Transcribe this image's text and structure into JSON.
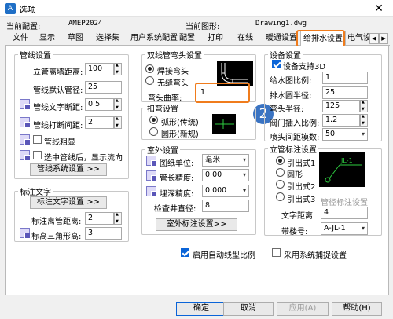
{
  "window": {
    "title": "选项",
    "close": "✕"
  },
  "info": {
    "current_config_label": "当前配置:",
    "current_config_value": "AMEP2024",
    "current_drawing_label": "当前图形:",
    "current_drawing_value": "Drawing1.dwg"
  },
  "tabs": [
    {
      "label": "文件"
    },
    {
      "label": "显示"
    },
    {
      "label": "草图"
    },
    {
      "label": "选择集"
    },
    {
      "label": "用户系统配置"
    },
    {
      "label": "配置"
    },
    {
      "label": "打印"
    },
    {
      "label": "在线"
    },
    {
      "label": "暖通设置"
    },
    {
      "label": "给排水设置"
    },
    {
      "label": "电气设"
    }
  ],
  "pipe": {
    "title": "管线设置",
    "elev_label": "立管离墙距离:",
    "elev_value": "100",
    "dia_label": "管线默认管径:",
    "dia_value": "25",
    "text_gap_label": "管线文字断距:",
    "text_gap_value": "0.5",
    "break_gap_label": "管线打断间距:",
    "break_gap_value": "2",
    "bold_label": "管线粗显",
    "flow_label": "选中管线后，显示流向",
    "sys_button": "管线系统设置 >>"
  },
  "label_text": {
    "title": "标注文字",
    "button": "标注文字设置 >>",
    "dist_label": "标注离管距离:",
    "dist_value": "2",
    "tri_label": "标高三角形高:",
    "tri_value": "3"
  },
  "elbow": {
    "title": "双线管弯头设置",
    "welded_label": "焊接弯头",
    "seamless_label": "无缝弯头",
    "curv_label": "弯头曲率:",
    "curv_value": "1"
  },
  "bend": {
    "title": "扣弯设置",
    "arc_label": "弧形(传统)",
    "circle_label": "圆形(新规)"
  },
  "outdoor": {
    "title": "室外设置",
    "unit_label": "图纸单位:",
    "unit_value": "毫米",
    "len_label": "管长精度:",
    "len_value": "0.00",
    "depth_label": "埋深精度:",
    "depth_value": "0.000",
    "well_label": "检查井直径:",
    "well_value": "8",
    "button": "室外标注设置>>"
  },
  "device": {
    "title": "设备设置",
    "support3d_label": "设备支持3D",
    "scale_label": "给水图比例:",
    "scale_value": "1",
    "drain_radius_label": "排水圆半径:",
    "drain_radius_value": "25",
    "elbow_radius_label": "弯头半径:",
    "elbow_radius_value": "125",
    "valve_label": "阀门插入比例:",
    "valve_value": "1.2",
    "spray_label": "喷头间距模数:",
    "spray_value": "50"
  },
  "riser": {
    "title": "立管标注设置",
    "opt1": "引出式1",
    "opt2": "圆形",
    "opt3": "引出式2",
    "opt4": "引出式3",
    "pipe_diameter_label": "管径标注设置",
    "text_dist_label": "文字距离",
    "text_dist_value": "4",
    "tag_label": "带楼号:",
    "tag_value": "A-JL-1",
    "preview_label": "JL-1"
  },
  "options": {
    "auto_linetype": "启用自动线型比例",
    "sys_snap": "采用系统捕捉设置"
  },
  "footer": {
    "ok": "确定",
    "cancel": "取消",
    "apply": "应用(A)",
    "help": "帮助(H)"
  },
  "annotations": {
    "badge1": "1",
    "badge2": "2"
  },
  "colors": {
    "highlight": "#f07c1c",
    "badge": "#3a73c2",
    "accent": "#0a64d8"
  }
}
